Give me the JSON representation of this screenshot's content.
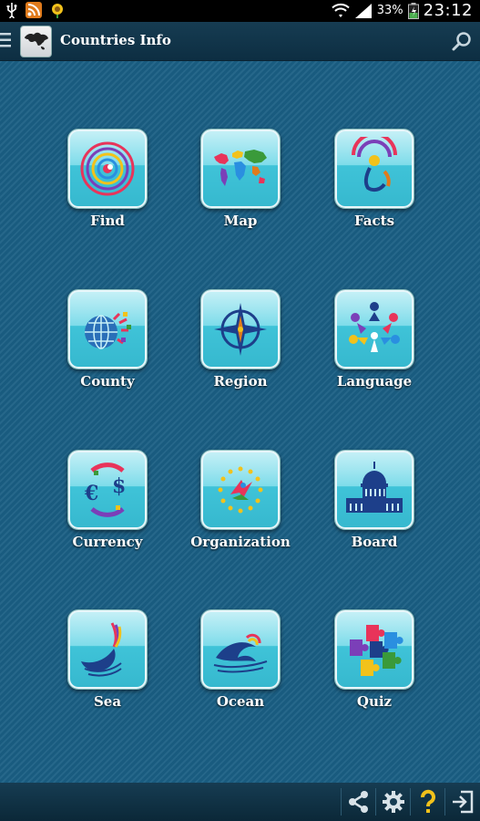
{
  "status_bar": {
    "battery_percent": "33%",
    "time": "23:12",
    "icons": [
      "usb-icon",
      "rss-icon",
      "sunflower-icon",
      "wifi-icon",
      "signal-icon",
      "battery-icon"
    ]
  },
  "action_bar": {
    "title": "Countries Info",
    "icons": [
      "menu-icon",
      "app-logo-icon",
      "search-icon"
    ]
  },
  "grid": {
    "tiles": [
      {
        "label": "Find",
        "icon": "target-icon"
      },
      {
        "label": "Map",
        "icon": "world-map-icon"
      },
      {
        "label": "Facts",
        "icon": "people-icon"
      },
      {
        "label": "County",
        "icon": "globe-icon"
      },
      {
        "label": "Region",
        "icon": "compass-icon"
      },
      {
        "label": "Language",
        "icon": "people-circle-icon"
      },
      {
        "label": "Currency",
        "icon": "currency-icon"
      },
      {
        "label": "Organization",
        "icon": "stars-circle-icon"
      },
      {
        "label": "Board",
        "icon": "capitol-icon"
      },
      {
        "label": "Sea",
        "icon": "sea-wave-icon"
      },
      {
        "label": "Ocean",
        "icon": "ocean-wave-icon"
      },
      {
        "label": "Quiz",
        "icon": "puzzle-icon"
      }
    ]
  },
  "bottom_bar": {
    "icons": [
      "share-icon",
      "settings-icon",
      "help-icon",
      "exit-icon"
    ]
  },
  "colors": {
    "background": "#1a5f84",
    "bar": "#163c52",
    "tile": "#3fc3d8"
  }
}
